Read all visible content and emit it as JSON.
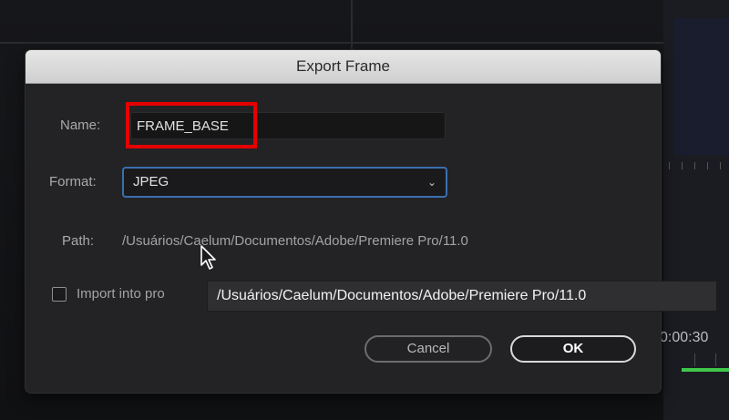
{
  "dialog": {
    "title": "Export Frame",
    "name_label": "Name:",
    "name_value": "FRAME_BASE",
    "format_label": "Format:",
    "format_value": "JPEG",
    "path_label": "Path:",
    "path_value": "/Usuários/Caelum/Documentos/Adobe/Premiere Pro/11.0",
    "import_label": "Import into pro",
    "import_checked": false,
    "cancel_label": "Cancel",
    "ok_label": "OK"
  },
  "tooltip": {
    "text": "/Usuários/Caelum/Documentos/Adobe/Premiere Pro/11.0"
  },
  "background": {
    "timecode": "0:00:30"
  },
  "icons": {
    "format_dropdown": "chevron-down-icon",
    "cursor": "mouse-pointer-icon"
  },
  "colors": {
    "highlight": "#e60000",
    "focus_ring": "#3b6fb0",
    "timeline_green": "#3fc84a"
  }
}
